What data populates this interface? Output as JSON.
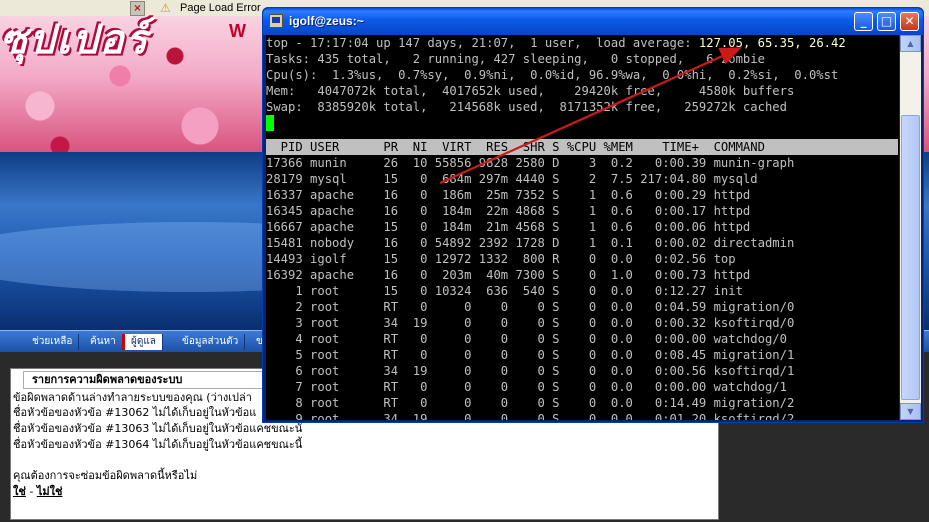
{
  "browser": {
    "tab_close": "×",
    "tab_warning": "⚠",
    "tab_title": "Page Load Error",
    "banner_logo": "ซุปเปอร์",
    "banner_side": "W",
    "nav": [
      "ช่วยเหลือ",
      "ค้นหา",
      "ผู้ดูแล",
      "ข้อมูลส่วนตัว",
      "ข"
    ],
    "dialog": {
      "title": "รายการความผิดพลาดของระบบ",
      "lines": [
        "ข้อผิดพลาดด้านล่างทำลายระบบของคุณ (ว่างเปล่า",
        "ชื่อหัวข้อของหัวข้อ #13062 ไม่ได้เก็บอยู่ในหัวข้อแ",
        "ชื่อหัวข้อของหัวข้อ #13063 ไม่ได้เก็บอยู่ในหัวข้อแคชขณะนั",
        "ชื่อหัวข้อของหัวข้อ #13064 ไม่ได้เก็บอยู่ในหัวข้อแคชขณะนี้",
        "คุณต้องการจะซ่อมข้อผิดพลาดนี้หรือไม่"
      ],
      "yes": "ใช่",
      "separator": " - ",
      "no": "ไม่ใช่"
    }
  },
  "putty": {
    "title": "igolf@zeus:~",
    "buttons": {
      "minimize": "_",
      "maximize": "□",
      "close": "✕"
    },
    "scroll_up": "▲",
    "scroll_down": "▼",
    "summary": {
      "top_prefix": "top - 17:17:04 up 147 days, 21:07,  1 user,  load average: ",
      "load_average": "127.05, 65.35, 26.42",
      "tasks": "Tasks: 435 total,   2 running, 427 sleeping,   0 stopped,   6 zombie",
      "cpu": "Cpu(s):  1.3%us,  0.7%sy,  0.9%ni,  0.0%id, 96.9%wa,  0.0%hi,  0.2%si,  0.0%st",
      "mem": "Mem:   4047072k total,  4017652k used,    29420k free,     4580k buffers",
      "swap": "Swap:  8385920k total,   214568k used,  8171352k free,   259272k cached"
    },
    "header": "  PID USER      PR  NI  VIRT  RES  SHR S %CPU %MEM    TIME+  COMMAND",
    "processes": [
      "17366 munin     26  10 55856 9828 2580 D    3  0.2   0:00.39 munin-graph",
      "28179 mysql     15   0  684m 297m 4440 S    2  7.5 217:04.80 mysqld",
      "16337 apache    16   0  186m  25m 7352 S    1  0.6   0:00.29 httpd",
      "16345 apache    16   0  184m  22m 4868 S    1  0.6   0:00.17 httpd",
      "16667 apache    15   0  184m  21m 4568 S    1  0.6   0:00.06 httpd",
      "15481 nobody    16   0 54892 2392 1728 D    1  0.1   0:00.02 directadmin",
      "14493 igolf     15   0 12972 1332  800 R    0  0.0   0:02.56 top",
      "16392 apache    16   0  203m  40m 7300 S    0  1.0   0:00.73 httpd",
      "    1 root      15   0 10324  636  540 S    0  0.0   0:12.27 init",
      "    2 root      RT   0     0    0    0 S    0  0.0   0:04.59 migration/0",
      "    3 root      34  19     0    0    0 S    0  0.0   0:00.32 ksoftirqd/0",
      "    4 root      RT   0     0    0    0 S    0  0.0   0:00.00 watchdog/0",
      "    5 root      RT   0     0    0    0 S    0  0.0   0:08.45 migration/1",
      "    6 root      34  19     0    0    0 S    0  0.0   0:00.56 ksoftirqd/1",
      "    7 root      RT   0     0    0    0 S    0  0.0   0:00.00 watchdog/1",
      "    8 root      RT   0     0    0    0 S    0  0.0   0:14.49 migration/2",
      "    9 root      34  19     0    0    0 S    0  0.0   0:01.20 ksoftirqd/2"
    ]
  },
  "annotation": {
    "arrow_color": "#cc1a1a"
  }
}
